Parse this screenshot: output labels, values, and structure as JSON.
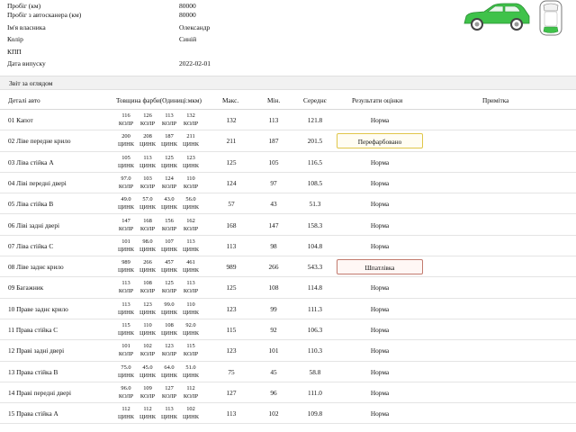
{
  "info": [
    {
      "label": "Пробіг (км)",
      "value": "80000"
    },
    {
      "label": "Пробіг з автосканера (км)",
      "value": "80000"
    },
    {
      "label": "Ім'я власника",
      "value": "Олександр"
    },
    {
      "label": "Колір",
      "value": "Синій"
    },
    {
      "label": "КПП",
      "value": ""
    },
    {
      "label": "Дата випуску",
      "value": "2022-02-01"
    }
  ],
  "section_title": "Звіт за оглядом",
  "headers": {
    "part": "Деталі авто",
    "paint": "Товщина фарби(Одиниці:мкм)",
    "max": "Макс.",
    "min": "Мін.",
    "avg": "Середнє",
    "result": "Результати оцінки",
    "note": "Примітка"
  },
  "colors": {
    "car_green": "#3fc24a",
    "yellow_border": "#e0c64a",
    "red_border": "#c27a6e"
  },
  "rows": [
    {
      "part": "01 Капот",
      "paint": [
        [
          "116",
          "КОЛР"
        ],
        [
          "126",
          "КОЛР"
        ],
        [
          "113",
          "КОЛР"
        ],
        [
          "132",
          "КОЛР"
        ]
      ],
      "max": "132",
      "min": "113",
      "avg": "121.8",
      "result": "Норма",
      "style": ""
    },
    {
      "part": "02 Ліве передне крило",
      "paint": [
        [
          "200",
          "ЦИНК"
        ],
        [
          "208",
          "ЦИНК"
        ],
        [
          "187",
          "ЦИНК"
        ],
        [
          "211",
          "ЦИНК"
        ]
      ],
      "max": "211",
      "min": "187",
      "avg": "201.5",
      "result": "Перефарбовано",
      "style": "yellow"
    },
    {
      "part": "03 Ліва стійка A",
      "paint": [
        [
          "105",
          "ЦИНК"
        ],
        [
          "113",
          "ЦИНК"
        ],
        [
          "125",
          "ЦИНК"
        ],
        [
          "123",
          "ЦИНК"
        ]
      ],
      "max": "125",
      "min": "105",
      "avg": "116.5",
      "result": "Норма",
      "style": ""
    },
    {
      "part": "04 Ліві передні двері",
      "paint": [
        [
          "97.0",
          "КОЛР"
        ],
        [
          "103",
          "КОЛР"
        ],
        [
          "124",
          "КОЛР"
        ],
        [
          "110",
          "КОЛР"
        ]
      ],
      "max": "124",
      "min": "97",
      "avg": "108.5",
      "result": "Норма",
      "style": ""
    },
    {
      "part": "05 Ліва стійка B",
      "paint": [
        [
          "49.0",
          "ЦИНК"
        ],
        [
          "57.0",
          "ЦИНК"
        ],
        [
          "43.0",
          "ЦИНК"
        ],
        [
          "56.0",
          "ЦИНК"
        ]
      ],
      "max": "57",
      "min": "43",
      "avg": "51.3",
      "result": "Норма",
      "style": ""
    },
    {
      "part": "06 Ліві задні двері",
      "paint": [
        [
          "147",
          "КОЛР"
        ],
        [
          "168",
          "КОЛР"
        ],
        [
          "156",
          "КОЛР"
        ],
        [
          "162",
          "КОЛР"
        ]
      ],
      "max": "168",
      "min": "147",
      "avg": "158.3",
      "result": "Норма",
      "style": ""
    },
    {
      "part": "07 Ліва стійка C",
      "paint": [
        [
          "101",
          "ЦИНК"
        ],
        [
          "98.0",
          "ЦИНК"
        ],
        [
          "107",
          "ЦИНК"
        ],
        [
          "113",
          "ЦИНК"
        ]
      ],
      "max": "113",
      "min": "98",
      "avg": "104.8",
      "result": "Норма",
      "style": ""
    },
    {
      "part": "08 Ліве заднє крило",
      "paint": [
        [
          "989",
          "ЦИНК"
        ],
        [
          "266",
          "ЦИНК"
        ],
        [
          "457",
          "ЦИНК"
        ],
        [
          "461",
          "ЦИНК"
        ]
      ],
      "max": "989",
      "min": "266",
      "avg": "543.3",
      "result": "Шпатлівка",
      "style": "red"
    },
    {
      "part": "09 Багажник",
      "paint": [
        [
          "113",
          "КОЛР"
        ],
        [
          "108",
          "КОЛР"
        ],
        [
          "125",
          "КОЛР"
        ],
        [
          "113",
          "КОЛР"
        ]
      ],
      "max": "125",
      "min": "108",
      "avg": "114.8",
      "result": "Норма",
      "style": ""
    },
    {
      "part": "10 Праве заднє крило",
      "paint": [
        [
          "113",
          "ЦИНК"
        ],
        [
          "123",
          "ЦИНК"
        ],
        [
          "99.0",
          "ЦИНК"
        ],
        [
          "110",
          "ЦИНК"
        ]
      ],
      "max": "123",
      "min": "99",
      "avg": "111.3",
      "result": "Норма",
      "style": ""
    },
    {
      "part": "11 Права стійка C",
      "paint": [
        [
          "115",
          "ЦИНК"
        ],
        [
          "110",
          "ЦИНК"
        ],
        [
          "108",
          "ЦИНК"
        ],
        [
          "92.0",
          "ЦИНК"
        ]
      ],
      "max": "115",
      "min": "92",
      "avg": "106.3",
      "result": "Норма",
      "style": ""
    },
    {
      "part": "12 Праві задні двері",
      "paint": [
        [
          "101",
          "КОЛР"
        ],
        [
          "102",
          "КОЛР"
        ],
        [
          "123",
          "КОЛР"
        ],
        [
          "115",
          "КОЛР"
        ]
      ],
      "max": "123",
      "min": "101",
      "avg": "110.3",
      "result": "Норма",
      "style": ""
    },
    {
      "part": "13 Права стійка B",
      "paint": [
        [
          "75.0",
          "ЦИНК"
        ],
        [
          "45.0",
          "ЦИНК"
        ],
        [
          "64.0",
          "ЦИНК"
        ],
        [
          "51.0",
          "ЦИНК"
        ]
      ],
      "max": "75",
      "min": "45",
      "avg": "58.8",
      "result": "Норма",
      "style": ""
    },
    {
      "part": "14 Праві передні двері",
      "paint": [
        [
          "96.0",
          "КОЛР"
        ],
        [
          "109",
          "КОЛР"
        ],
        [
          "127",
          "КОЛР"
        ],
        [
          "112",
          "КОЛР"
        ]
      ],
      "max": "127",
      "min": "96",
      "avg": "111.0",
      "result": "Норма",
      "style": ""
    },
    {
      "part": "15 Права стійка A",
      "paint": [
        [
          "112",
          "ЦИНК"
        ],
        [
          "112",
          "ЦИНК"
        ],
        [
          "113",
          "ЦИНК"
        ],
        [
          "102",
          "ЦИНК"
        ]
      ],
      "max": "113",
      "min": "102",
      "avg": "109.8",
      "result": "Норма",
      "style": ""
    }
  ]
}
